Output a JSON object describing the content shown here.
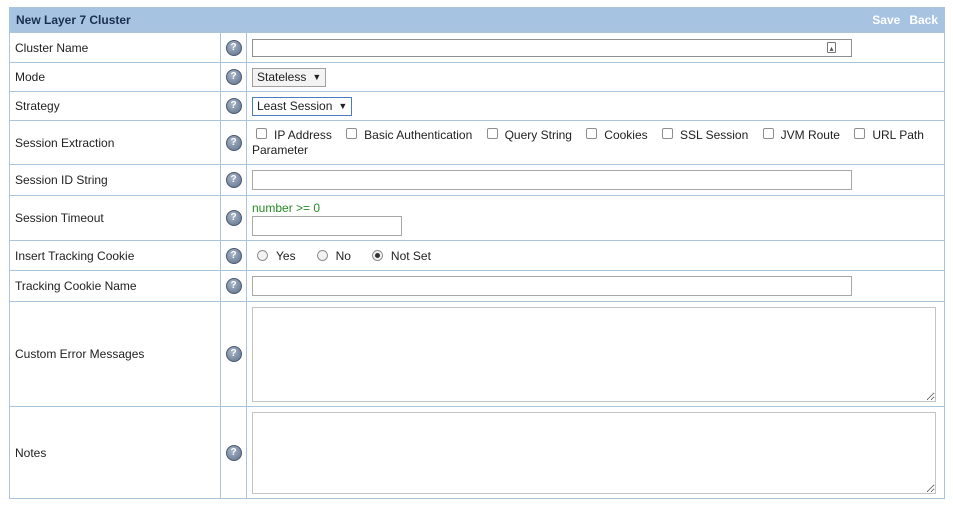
{
  "header": {
    "title": "New Layer 7 Cluster",
    "save_label": "Save",
    "back_label": "Back"
  },
  "fields": {
    "cluster_name": {
      "label": "Cluster Name",
      "value": ""
    },
    "mode": {
      "label": "Mode",
      "selected": "Stateless"
    },
    "strategy": {
      "label": "Strategy",
      "selected": "Least Session"
    },
    "session_extraction": {
      "label": "Session Extraction",
      "options": [
        "IP Address",
        "Basic Authentication",
        "Query String",
        "Cookies",
        "SSL Session",
        "JVM Route",
        "URL Path"
      ],
      "wrap_text": "Parameter"
    },
    "session_id_string": {
      "label": "Session ID String",
      "value": ""
    },
    "session_timeout": {
      "label": "Session Timeout",
      "hint": "number >= 0",
      "value": ""
    },
    "insert_tracking_cookie": {
      "label": "Insert Tracking Cookie",
      "options": [
        "Yes",
        "No",
        "Not Set"
      ],
      "selected": "Not Set"
    },
    "tracking_cookie_name": {
      "label": "Tracking Cookie Name",
      "value": ""
    },
    "custom_error_messages": {
      "label": "Custom Error Messages",
      "value": ""
    },
    "notes": {
      "label": "Notes",
      "value": ""
    }
  },
  "help_glyph": "?",
  "colors": {
    "header_bg": "#a6c3e2",
    "border": "#a9c4dc",
    "hint": "#228b22"
  }
}
